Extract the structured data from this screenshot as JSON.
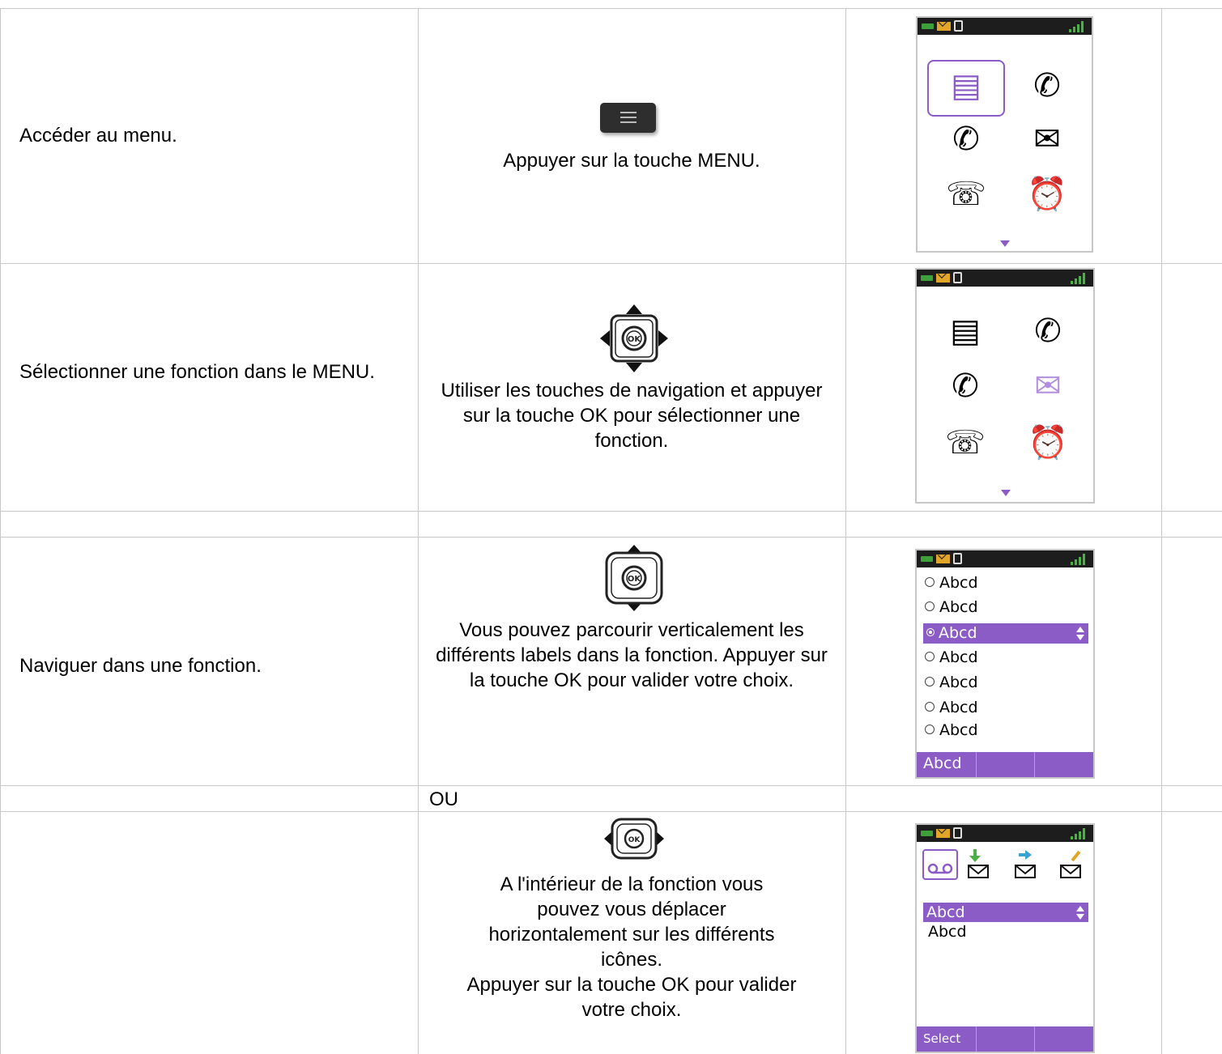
{
  "rows": [
    {
      "action": "Accéder au menu.",
      "instruction": "Appuyer sur la touche MENU."
    },
    {
      "action": "Sélectionner une fonction dans le MENU.",
      "instruction": "Utiliser les touches de navigation et appuyer sur la touche OK pour sélectionner une fonction."
    },
    {
      "action": "Naviguer dans une fonction.",
      "instruction": "Vous pouvez parcourir verticalement les différents labels dans la fonction. Appuyer sur la touche OK pour valider votre choix."
    },
    {
      "separator": "OU"
    },
    {
      "action": "",
      "instruction_lines": [
        "A l'intérieur de la fonction vous",
        "pouvez vous déplacer",
        "horizontalement sur les différents",
        "icônes.",
        "Appuyer sur la touche OK pour valider",
        "votre choix."
      ]
    }
  ],
  "ok_label": "OK",
  "list_screen": {
    "items": [
      "Abcd",
      "Abcd",
      "Abcd",
      "Abcd",
      "Abcd",
      "Abcd",
      "Abcd"
    ],
    "selected_index": 2,
    "softkey": "Abcd"
  },
  "tab_screen": {
    "items": [
      "Abcd",
      "Abcd"
    ],
    "softkey": "Select"
  },
  "icons": {
    "menu_grid": [
      "contacts-icon",
      "incoming-call-icon",
      "outgoing-call-icon",
      "message-icon",
      "handset-icon",
      "alarm-clock-icon"
    ],
    "tab_strip": [
      "voicemail-icon",
      "inbox-icon",
      "outbox-icon",
      "compose-icon"
    ]
  },
  "colors": {
    "accent": "#8b5cc6",
    "grid": "#c8c8c8",
    "statusbar": "#1d1d1d",
    "battery": "#3ea03a",
    "signal": "#4bb147"
  }
}
